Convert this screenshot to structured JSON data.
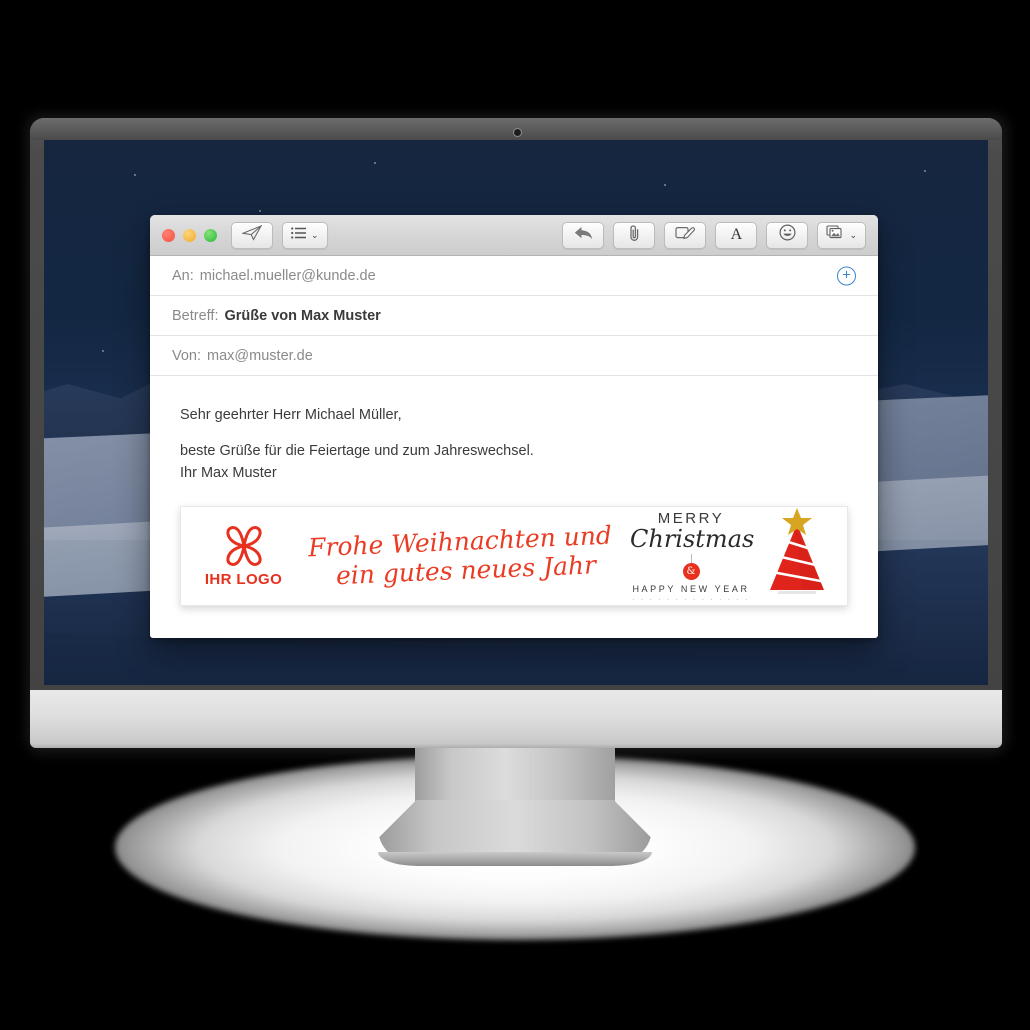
{
  "device": {
    "type": "desktop-monitor",
    "wallpaper": "night-desert-dunes",
    "camera_icon": "camera-dot-icon"
  },
  "mail_window": {
    "titlebar": {
      "traffic_lights": [
        {
          "name": "close",
          "color": "#f4503f"
        },
        {
          "name": "minimize",
          "color": "#f0ab2e"
        },
        {
          "name": "zoom",
          "color": "#28ba35"
        }
      ],
      "left_buttons": [
        {
          "icon": "send-paper-plane-icon",
          "label": ""
        },
        {
          "icon": "list-lines-icon",
          "label": "",
          "chevron": "⌄"
        }
      ],
      "right_buttons": [
        {
          "icon": "reply-arrow-icon",
          "label": ""
        },
        {
          "icon": "paperclip-attach-icon",
          "label": ""
        },
        {
          "icon": "markup-signature-icon",
          "label": ""
        },
        {
          "icon": "format-text-icon",
          "label": "A"
        },
        {
          "icon": "emoji-smiley-icon",
          "label": ""
        },
        {
          "icon": "photo-browser-icon",
          "label": "",
          "chevron": "⌄"
        }
      ]
    },
    "fields": [
      {
        "label": "An:",
        "value": "michael.mueller@kunde.de",
        "bold": false,
        "name": "to"
      },
      {
        "label": "Betreff:",
        "value": "Grüße von Max Muster",
        "bold": true,
        "name": "subject"
      },
      {
        "label": "Von:",
        "value": "max@muster.de",
        "bold": false,
        "name": "from"
      }
    ],
    "add_recipient_icon": "plus-circle-icon",
    "body": {
      "salutation": "Sehr geehrter Herr Michael Müller,",
      "line1": "beste Grüße für die Feiertage und zum Jahreswechsel.",
      "line2": "Ihr Max Muster"
    },
    "signature_banner": {
      "logo": {
        "mark_icon": "four-petal-flower-icon",
        "text": "IHR LOGO",
        "color": "#e8301f"
      },
      "greeting_line1": "Frohe Weihnachten und",
      "greeting_line2": "ein gutes neues Jahr",
      "greeting_color": "#ea3b23",
      "christmas_card": {
        "merry": "MERRY",
        "christmas": "Christmas",
        "ornament_char": "&",
        "happy_new_year": "HAPPY NEW YEAR",
        "dots": ". . . . . . . . . . . . . .",
        "tree_icon": "christmas-tree-icon",
        "star_icon": "star-icon",
        "tree_color": "#e0241c",
        "star_color": "#d6a521"
      }
    }
  }
}
